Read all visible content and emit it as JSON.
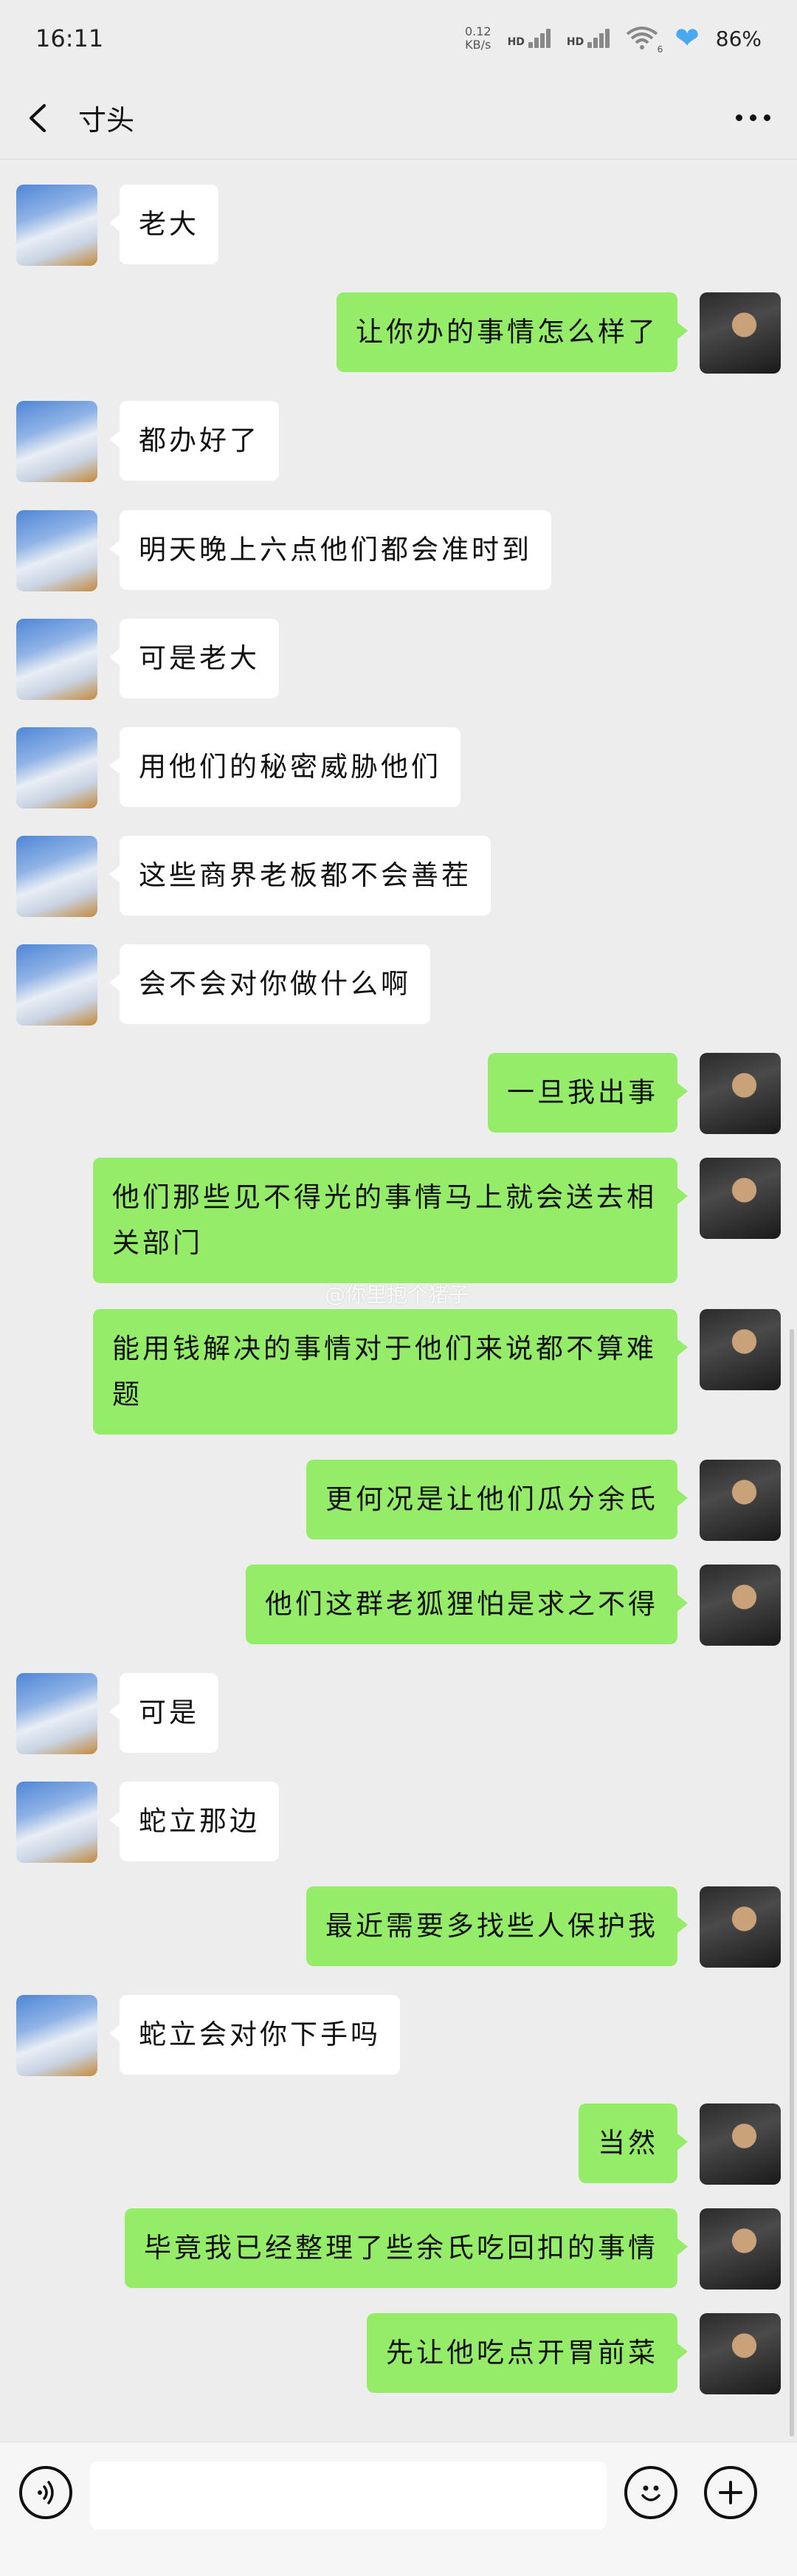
{
  "status_bar": {
    "time": "16:11",
    "net_speed_value": "0.12",
    "net_speed_unit": "KB/s",
    "hd1": "HD",
    "hd2": "HD",
    "wifi_label": "6",
    "battery": "86%"
  },
  "header": {
    "title": "寸头"
  },
  "messages": [
    {
      "side": "in",
      "text": "老大"
    },
    {
      "side": "out",
      "text": "让你办的事情怎么样了"
    },
    {
      "side": "in",
      "text": "都办好了"
    },
    {
      "side": "in",
      "text": "明天晚上六点他们都会准时到"
    },
    {
      "side": "in",
      "text": "可是老大"
    },
    {
      "side": "in",
      "text": "用他们的秘密威胁他们"
    },
    {
      "side": "in",
      "text": "这些商界老板都不会善茬"
    },
    {
      "side": "in",
      "text": "会不会对你做什么啊"
    },
    {
      "side": "out",
      "text": "一旦我出事"
    },
    {
      "side": "out",
      "text": "他们那些见不得光的事情马上就会送去相关部门"
    },
    {
      "side": "out",
      "text": "能用钱解决的事情对于他们来说都不算难题"
    },
    {
      "side": "out",
      "text": "更何况是让他们瓜分余氏"
    },
    {
      "side": "out",
      "text": "他们这群老狐狸怕是求之不得"
    },
    {
      "side": "in",
      "text": "可是"
    },
    {
      "side": "in",
      "text": "蛇立那边"
    },
    {
      "side": "out",
      "text": "最近需要多找些人保护我"
    },
    {
      "side": "in",
      "text": "蛇立会对你下手吗"
    },
    {
      "side": "out",
      "text": "当然"
    },
    {
      "side": "out",
      "text": "毕竟我已经整理了些余氏吃回扣的事情"
    },
    {
      "side": "out",
      "text": "先让他吃点开胃前菜"
    }
  ],
  "watermark": "@你里抱个猪子",
  "input_bar": {
    "voice_icon": "voice-icon",
    "emoji_icon": "emoji-icon",
    "add_icon": "plus-icon",
    "input_value": ""
  },
  "colors": {
    "background": "#ededed",
    "incoming_bubble": "#ffffff",
    "outgoing_bubble": "#95ec69"
  }
}
